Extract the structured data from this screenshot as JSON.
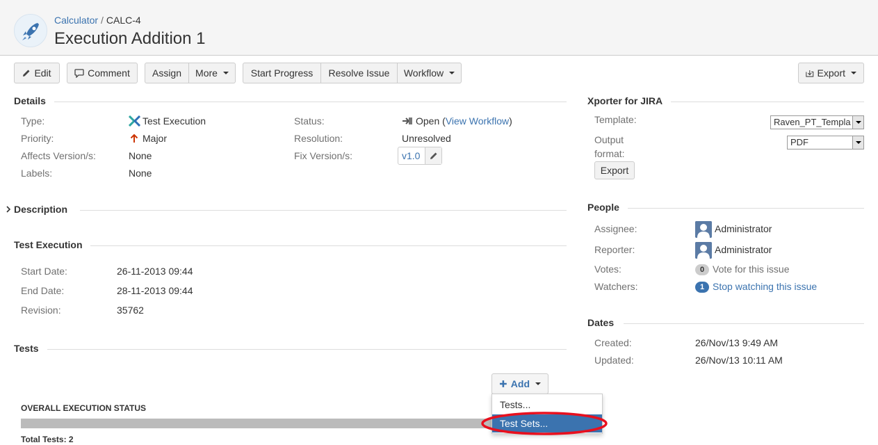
{
  "header": {
    "project_link": "Calculator",
    "separator": "/",
    "issue_key": "CALC-4",
    "title": "Execution Addition 1"
  },
  "toolbar": {
    "edit": "Edit",
    "comment": "Comment",
    "assign": "Assign",
    "more": "More",
    "start_progress": "Start Progress",
    "resolve_issue": "Resolve Issue",
    "workflow": "Workflow",
    "export": "Export"
  },
  "details": {
    "title": "Details",
    "type_label": "Type:",
    "type_value": "Test Execution",
    "priority_label": "Priority:",
    "priority_value": "Major",
    "affects_label": "Affects Version/s:",
    "affects_value": "None",
    "labels_label": "Labels:",
    "labels_value": "None",
    "status_label": "Status:",
    "status_value": "Open",
    "status_paren_open": "(",
    "status_workflow_link": "View Workflow",
    "status_paren_close": ")",
    "resolution_label": "Resolution:",
    "resolution_value": "Unresolved",
    "fix_label": "Fix Version/s:",
    "fix_value": "v1.0"
  },
  "description": {
    "title": "Description"
  },
  "test_execution": {
    "title": "Test Execution",
    "start_label": "Start Date:",
    "start_value": "26-11-2013 09:44",
    "end_label": "End Date:",
    "end_value": "28-11-2013 09:44",
    "revision_label": "Revision:",
    "revision_value": "35762"
  },
  "tests": {
    "title": "Tests",
    "add_button": "Add",
    "overall_status": "OVERALL EXECUTION STATUS",
    "total_tests": "Total Tests: 2",
    "progress_fraction": 1.0
  },
  "add_menu": {
    "items": [
      "Tests...",
      "Test Sets..."
    ],
    "selected_index": 1
  },
  "xporter": {
    "title": "Xporter for JIRA",
    "template_label": "Template:",
    "template_value": "Raven_PT_Templa",
    "output_label_1": "Output",
    "output_label_2": "format:",
    "output_value": "PDF",
    "export_button": "Export"
  },
  "people": {
    "title": "People",
    "assignee_label": "Assignee:",
    "assignee_value": "Administrator",
    "reporter_label": "Reporter:",
    "reporter_value": "Administrator",
    "votes_label": "Votes:",
    "votes_count": "0",
    "votes_link": "Vote for this issue",
    "watchers_label": "Watchers:",
    "watchers_count": "1",
    "watchers_link": "Stop watching this issue"
  },
  "dates": {
    "title": "Dates",
    "created_label": "Created:",
    "created_value": "26/Nov/13 9:49 AM",
    "updated_label": "Updated:",
    "updated_value": "26/Nov/13 10:11 AM"
  },
  "colors": {
    "link": "#3b73af",
    "selected_item": "#3b73af",
    "highlight_ring": "#e8101e",
    "progress_bar": "#bbbbbb"
  },
  "icons": {
    "project": "rocket-icon",
    "edit": "pencil-icon",
    "comment": "speech-bubble-icon",
    "export": "export-icon",
    "type": "test-execution-icon",
    "priority": "arrow-up-icon",
    "status": "status-open-icon",
    "add": "plus-icon",
    "description_toggle": "chevron-right-icon",
    "user": "user-avatar-icon"
  }
}
